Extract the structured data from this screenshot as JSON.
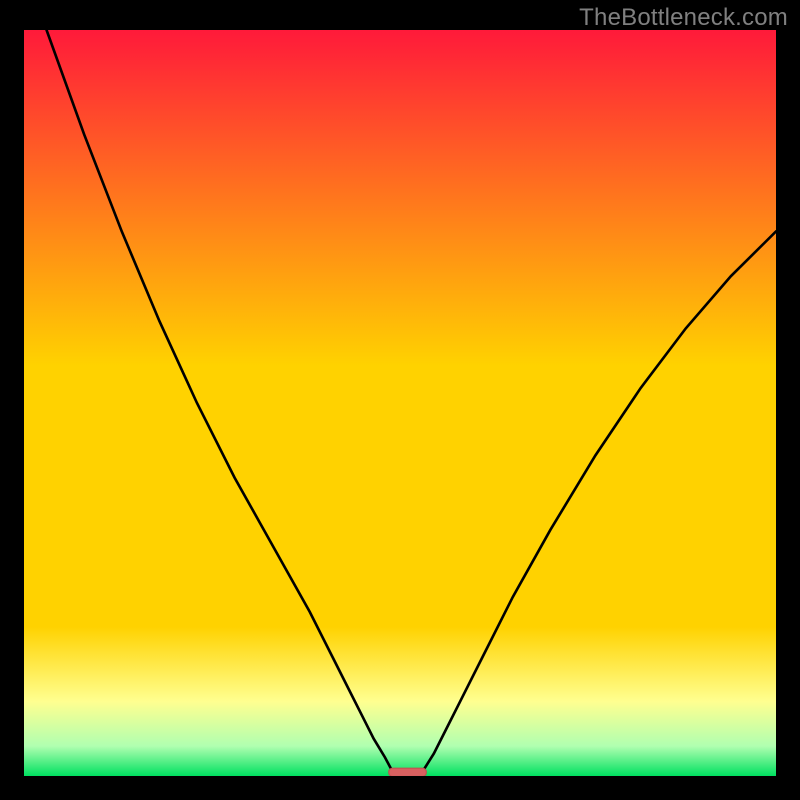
{
  "watermark": "TheBottleneck.com",
  "colors": {
    "frame": "#000000",
    "grad_top": "#ff1a3a",
    "grad_mid": "#ffd200",
    "grad_paleyellow": "#ffff90",
    "grad_palegreen": "#b0ffb0",
    "grad_green": "#00e060",
    "curve": "#000000",
    "marker_fill": "#d86060",
    "marker_stroke": "#c05050"
  },
  "chart_data": {
    "type": "line",
    "title": "",
    "xlabel": "",
    "ylabel": "",
    "xlim": [
      0,
      100
    ],
    "ylim": [
      0,
      100
    ],
    "comment": "Two curves descending to a common minimum (bottleneck) and a marker at the minimum. Values are bottleneck percentage estimates (100=top/red, 0=bottom/green).",
    "series": [
      {
        "name": "left-curve",
        "x": [
          3,
          8,
          13,
          18,
          23,
          28,
          33,
          38,
          41,
          43,
          45,
          46.5,
          48,
          49
        ],
        "values": [
          100,
          86,
          73,
          61,
          50,
          40,
          31,
          22,
          16,
          12,
          8,
          5,
          2.5,
          0.6
        ]
      },
      {
        "name": "right-curve",
        "x": [
          53,
          54.5,
          56,
          58,
          61,
          65,
          70,
          76,
          82,
          88,
          94,
          100
        ],
        "values": [
          0.6,
          3,
          6,
          10,
          16,
          24,
          33,
          43,
          52,
          60,
          67,
          73
        ]
      }
    ],
    "marker": {
      "x_range": [
        48.5,
        53.5
      ],
      "y": 0.5
    },
    "grid": false,
    "legend": false
  }
}
